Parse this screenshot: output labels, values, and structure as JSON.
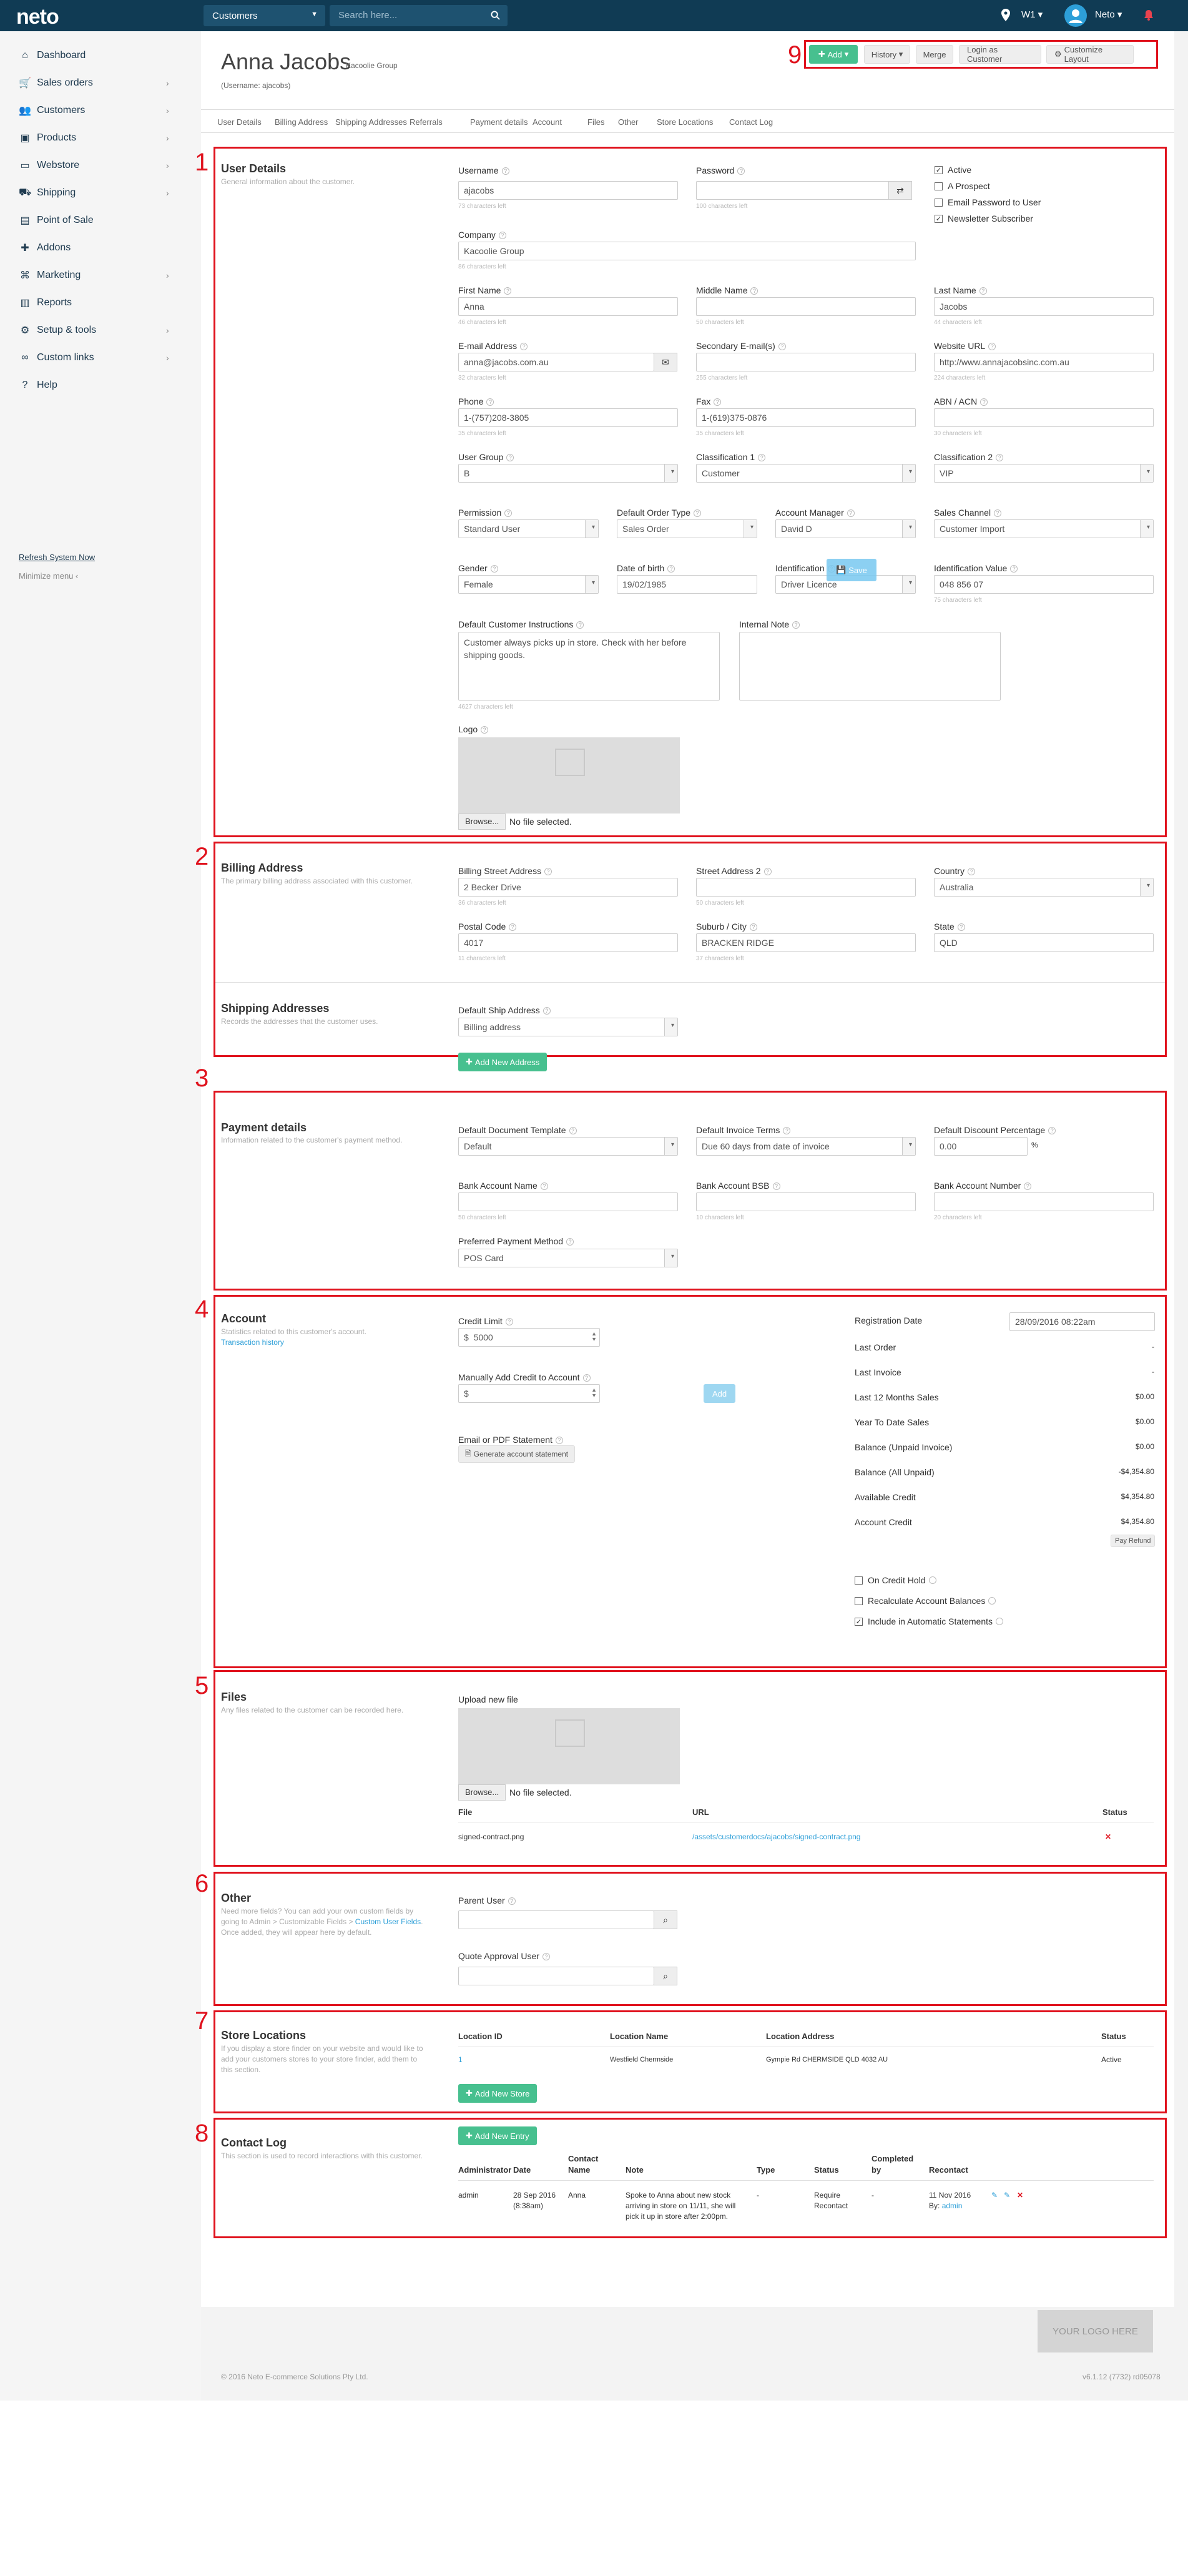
{
  "topbar": {
    "logo": "neto",
    "module": "Customers",
    "search_placeholder": "Search here...",
    "location": "W1",
    "user": "Neto"
  },
  "sidebar": {
    "items": [
      {
        "label": "Dashboard",
        "icon": "home-icon",
        "has_children": false
      },
      {
        "label": "Sales orders",
        "icon": "cart-icon",
        "has_children": true
      },
      {
        "label": "Customers",
        "icon": "users-icon",
        "has_children": true
      },
      {
        "label": "Products",
        "icon": "box-icon",
        "has_children": true
      },
      {
        "label": "Webstore",
        "icon": "monitor-icon",
        "has_children": true
      },
      {
        "label": "Shipping",
        "icon": "truck-icon",
        "has_children": true
      },
      {
        "label": "Point of Sale",
        "icon": "pos-icon",
        "has_children": false
      },
      {
        "label": "Addons",
        "icon": "addon-icon",
        "has_children": false
      },
      {
        "label": "Marketing",
        "icon": "tag-icon",
        "has_children": true
      },
      {
        "label": "Reports",
        "icon": "chart-icon",
        "has_children": false
      },
      {
        "label": "Setup & tools",
        "icon": "gear-icon",
        "has_children": true
      },
      {
        "label": "Custom links",
        "icon": "link-icon",
        "has_children": true
      },
      {
        "label": "Help",
        "icon": "help-icon",
        "has_children": false
      }
    ],
    "refresh": "Refresh System Now",
    "minimize": "Minimize menu"
  },
  "header": {
    "name": "Anna Jacobs",
    "company": "Kacoolie Group",
    "username_line": "(Username: ajacobs)",
    "actions": {
      "add": "Add",
      "history": "History",
      "merge": "Merge",
      "login_as": "Login as Customer",
      "customize": "Customize Layout"
    }
  },
  "tabs": [
    "User Details",
    "Billing Address",
    "Shipping Addresses",
    "Referrals",
    "Payment details",
    "Account",
    "Files",
    "Other",
    "Store Locations",
    "Contact Log"
  ],
  "annotations": [
    "1",
    "2",
    "3",
    "4",
    "5",
    "6",
    "7",
    "8",
    "9"
  ],
  "user_details": {
    "title": "User Details",
    "desc": "General information about the customer.",
    "username_label": "Username",
    "username": "ajacobs",
    "username_hint": "73 characters left",
    "password_label": "Password",
    "password_hint": "100 characters left",
    "active": "Active",
    "prospect": "A Prospect",
    "email_pw": "Email Password to User",
    "newsletter": "Newsletter Subscriber",
    "company_label": "Company",
    "company": "Kacoolie Group",
    "company_hint": "86 characters left",
    "first_label": "First Name",
    "first": "Anna",
    "first_hint": "46 characters left",
    "middle_label": "Middle Name",
    "middle_hint": "50 characters left",
    "last_label": "Last Name",
    "last": "Jacobs",
    "last_hint": "44 characters left",
    "email_label": "E-mail Address",
    "email": "anna@jacobs.com.au",
    "email_hint": "32 characters left",
    "sec_email_label": "Secondary E-mail(s)",
    "sec_email_hint": "255 characters left",
    "web_label": "Website URL",
    "web": "http://www.annajacobsinc.com.au",
    "web_hint": "224 characters left",
    "phone_label": "Phone",
    "phone": "1-(757)208-3805",
    "phone_hint": "35 characters left",
    "fax_label": "Fax",
    "fax": "1-(619)375-0876",
    "fax_hint": "35 characters left",
    "abn_label": "ABN / ACN",
    "abn_hint": "30 characters left",
    "group_label": "User Group",
    "group": "B",
    "class1_label": "Classification 1",
    "class1": "Customer",
    "class2_label": "Classification 2",
    "class2": "VIP",
    "perm_label": "Permission",
    "perm": "Standard User",
    "order_type_label": "Default Order Type",
    "order_type": "Sales Order",
    "acct_mgr_label": "Account Manager",
    "acct_mgr": "David D",
    "channel_label": "Sales Channel",
    "channel": "Customer Import",
    "gender_label": "Gender",
    "gender": "Female",
    "dob_label": "Date of birth",
    "dob": "19/02/1985",
    "ident_label": "Identification",
    "ident": "Driver Licence",
    "save_overlay": "Save",
    "ident_val_label": "Identification Value",
    "ident_val": "048 856 07",
    "ident_val_hint": "75 characters left",
    "instr_label": "Default Customer Instructions",
    "instr": "Customer always picks up in store. Check with her before shipping goods.",
    "instr_hint": "4627 characters left",
    "note_label": "Internal Note",
    "logo_label": "Logo",
    "browse": "Browse...",
    "nofile": "No file selected."
  },
  "billing": {
    "title": "Billing Address",
    "desc": "The primary billing address associated with this customer.",
    "street_label": "Billing Street Address",
    "street": "2 Becker Drive",
    "street_hint": "36 characters left",
    "street2_label": "Street Address 2",
    "street2_hint": "50 characters left",
    "country_label": "Country",
    "country": "Australia",
    "postcode_label": "Postal Code",
    "postcode": "4017",
    "postcode_hint": "11 characters left",
    "suburb_label": "Suburb / City",
    "suburb": "BRACKEN RIDGE",
    "suburb_hint": "37 characters left",
    "state_label": "State",
    "state": "QLD"
  },
  "shipping": {
    "title": "Shipping Addresses",
    "desc": "Records the addresses that the customer uses.",
    "default_label": "Default Ship Address",
    "default": "Billing address",
    "add_btn": "Add New Address"
  },
  "payment": {
    "title": "Payment details",
    "desc": "Information related to the customer's payment method.",
    "doc_tpl_label": "Default Document Template",
    "doc_tpl": "Default",
    "terms_label": "Default Invoice Terms",
    "terms": "Due 60 days from date of invoice",
    "discount_label": "Default Discount Percentage",
    "discount": "0.00",
    "pct": "%",
    "bank_name_label": "Bank Account Name",
    "bank_name_hint": "50 characters left",
    "bsb_label": "Bank Account BSB",
    "bsb_hint": "10 characters left",
    "bank_num_label": "Bank Account Number",
    "bank_num_hint": "20 characters left",
    "pay_method_label": "Preferred Payment Method",
    "pay_method": "POS Card"
  },
  "account": {
    "title": "Account",
    "desc": "Statistics related to this customer's account.",
    "history_link": "Transaction history",
    "credit_label": "Credit Limit",
    "currency": "$",
    "credit": "5000",
    "add_credit_label": "Manually Add Credit to Account",
    "add_btn": "Add",
    "statement_label": "Email or PDF Statement",
    "statement_btn": "Generate account statement",
    "reg_label": "Registration Date",
    "reg": "28/09/2016 08:22am",
    "stats": [
      {
        "label": "Last Order",
        "value": "-"
      },
      {
        "label": "Last Invoice",
        "value": "-"
      },
      {
        "label": "Last 12 Months Sales",
        "value": "$0.00"
      },
      {
        "label": "Year To Date Sales",
        "value": "$0.00"
      },
      {
        "label": "Balance (Unpaid Invoice)",
        "value": "$0.00"
      },
      {
        "label": "Balance (All Unpaid)",
        "value": "-$4,354.80"
      },
      {
        "label": "Available Credit",
        "value": "$4,354.80"
      },
      {
        "label": "Account Credit",
        "value": "$4,354.80"
      }
    ],
    "pay_refund": "Pay Refund",
    "credit_hold": "On Credit Hold",
    "recalc": "Recalculate Account Balances",
    "auto_stmt": "Include in Automatic Statements"
  },
  "files": {
    "title": "Files",
    "desc": "Any files related to the customer can be recorded here.",
    "upload_label": "Upload new file",
    "browse": "Browse...",
    "nofile": "No file selected.",
    "col_file": "File",
    "col_url": "URL",
    "col_status": "Status",
    "file_name": "signed-contract.png",
    "file_url": "/assets/customerdocs/ajacobs/signed-contract.png"
  },
  "other": {
    "title": "Other",
    "desc_1": "Need more fields? You can add your own custom fields by going to Admin > Customizable Fields > ",
    "desc_link": "Custom User Fields",
    "desc_2": ". Once added, they will appear here by default.",
    "parent_label": "Parent User",
    "quote_label": "Quote Approval User"
  },
  "stores": {
    "title": "Store Locations",
    "desc": "If you display a store finder on your website and would like to add your customers stores to your store finder, add them to this section.",
    "cols": [
      "Location ID",
      "Location Name",
      "Location Address",
      "Status"
    ],
    "row": {
      "id": "1",
      "name": "Westfield Chermside",
      "address": "Gympie Rd CHERMSIDE QLD 4032 AU",
      "status": "Active"
    },
    "add_btn": "Add New Store"
  },
  "contact_log": {
    "title": "Contact Log",
    "desc": "This section is used to record interactions with this customer.",
    "add_btn": "Add New Entry",
    "cols": [
      "Administrator",
      "Date",
      "Contact Name",
      "Note",
      "Type",
      "Status",
      "Completed by",
      "Recontact"
    ],
    "row": {
      "admin": "admin",
      "date": "28 Sep 2016 (8:38am)",
      "contact": "Anna",
      "note": "Spoke to Anna about new stock arriving in store on 11/11, she will pick it up in store after 2:00pm.",
      "type": "-",
      "status": "Require Recontact",
      "completed": "-",
      "recontact": "11 Nov 2016",
      "by_prefix": "By:",
      "by": "admin"
    }
  },
  "footer": {
    "logo": "YOUR LOGO HERE",
    "copyright": "© 2016 Neto E-commerce Solutions Pty Ltd.",
    "version": "v6.1.12 (7732) rd05078"
  },
  "colors": {
    "topbar": "#103b54",
    "accent_green": "#47c08f",
    "link": "#2d9fd8",
    "annotation_red": "#e0121d"
  }
}
